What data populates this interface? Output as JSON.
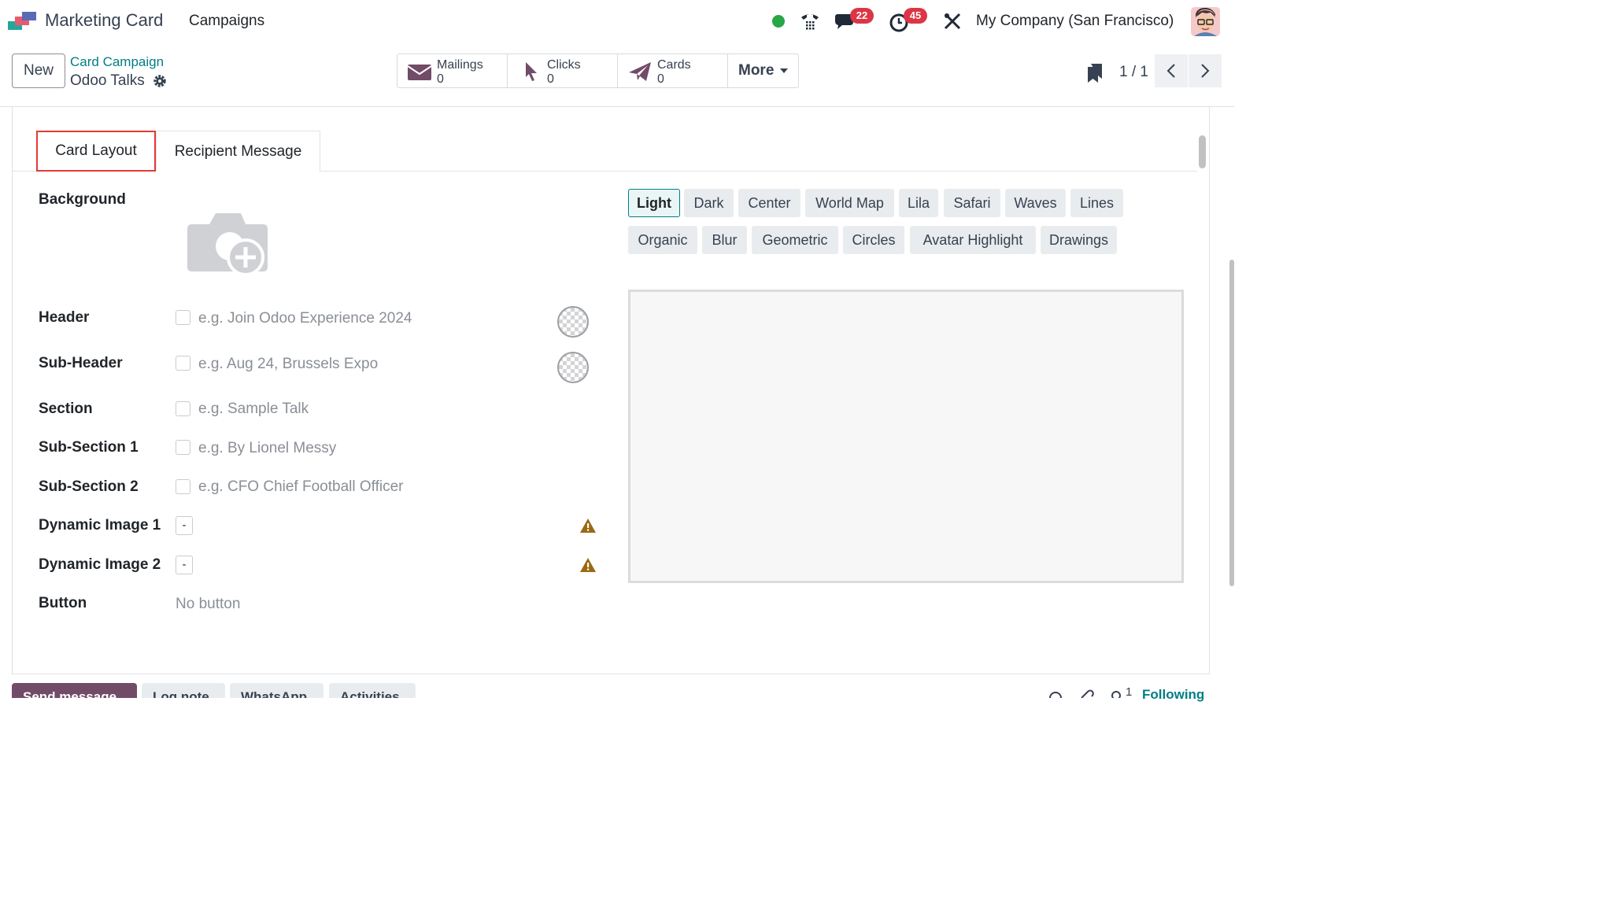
{
  "app": {
    "name": "Marketing Card",
    "menu": "Campaigns",
    "company": "My Company (San Francisco)",
    "messages_badge": "22",
    "activities_badge": "45"
  },
  "control": {
    "new_label": "New",
    "breadcrumb_parent": "Card Campaign",
    "breadcrumb_current": "Odoo Talks",
    "smart_buttons": [
      {
        "label": "Mailings",
        "value": "0"
      },
      {
        "label": "Clicks",
        "value": "0"
      },
      {
        "label": "Cards",
        "value": "0"
      }
    ],
    "more_label": "More",
    "pager": "1 / 1"
  },
  "tabs": {
    "card_layout": "Card Layout",
    "recipient_message": "Recipient Message"
  },
  "form": {
    "background": "Background",
    "header": {
      "label": "Header",
      "placeholder": "e.g. Join Odoo Experience 2024"
    },
    "sub_header": {
      "label": "Sub-Header",
      "placeholder": "e.g. Aug 24, Brussels Expo"
    },
    "section": {
      "label": "Section",
      "placeholder": "e.g. Sample Talk"
    },
    "sub_section_1": {
      "label": "Sub-Section 1",
      "placeholder": "e.g. By Lionel Messy"
    },
    "sub_section_2": {
      "label": "Sub-Section 2",
      "placeholder": "e.g. CFO Chief Football Officer"
    },
    "dynamic_image_1": {
      "label": "Dynamic Image 1",
      "value": "-"
    },
    "dynamic_image_2": {
      "label": "Dynamic Image 2",
      "value": "-"
    },
    "button": {
      "label": "Button",
      "value": "No button"
    }
  },
  "styles": {
    "options": [
      "Light",
      "Dark",
      "Center",
      "World Map",
      "Lila",
      "Safari",
      "Waves",
      "Lines",
      "Organic",
      "Blur",
      "Geometric",
      "Circles",
      "Avatar Highlight",
      "Drawings"
    ],
    "selected": "Light"
  },
  "chatter": {
    "buttons": [
      "Send message",
      "Log note",
      "WhatsApp",
      "Activities"
    ],
    "followers_count": "1",
    "following": "Following"
  },
  "colors": {
    "brand": "#017e84",
    "primary": "#714b67",
    "badge": "#dc3545",
    "online": "#28a745",
    "highlight": "#e53935",
    "warning": "#9a6a12"
  }
}
